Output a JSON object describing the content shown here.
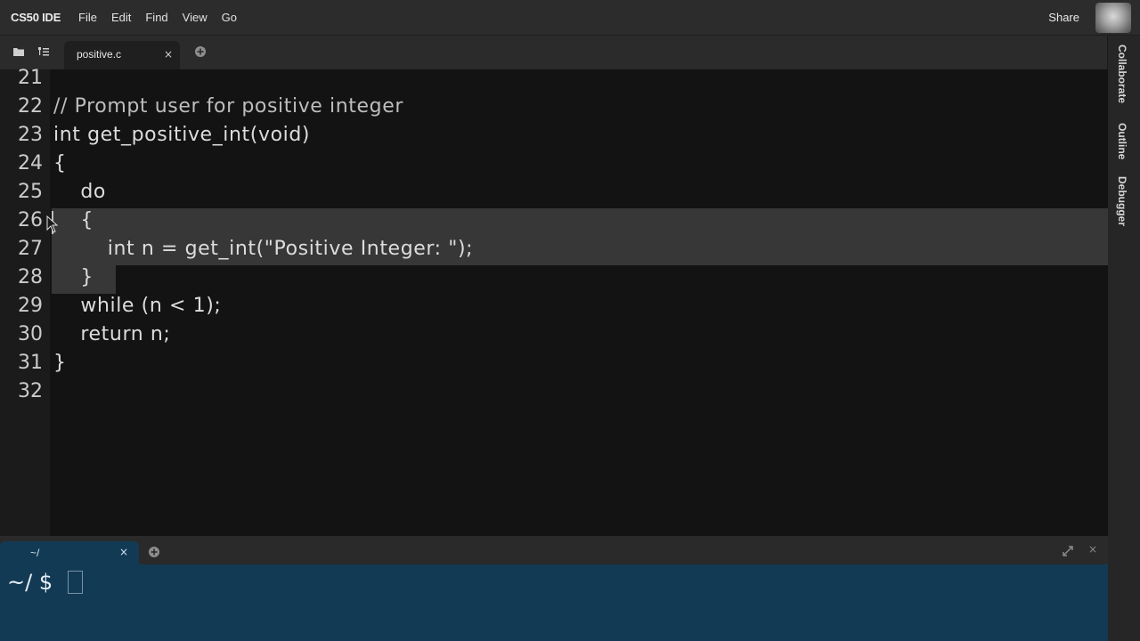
{
  "app": {
    "brand": "CS50 IDE",
    "menus": [
      "File",
      "Edit",
      "Find",
      "View",
      "Go"
    ],
    "share_label": "Share"
  },
  "tabs": {
    "active_tab": "positive.c",
    "close_glyph": "×"
  },
  "right_panel": {
    "labels": [
      "Collaborate",
      "Outline",
      "Debugger"
    ]
  },
  "editor": {
    "lines": [
      {
        "num": "21",
        "text": ""
      },
      {
        "num": "22",
        "text": "// Prompt user for positive integer"
      },
      {
        "num": "23",
        "text": "int get_positive_int(void)"
      },
      {
        "num": "24",
        "text": "{"
      },
      {
        "num": "25",
        "text": "    do"
      },
      {
        "num": "26",
        "text": "    {"
      },
      {
        "num": "27",
        "text": "        int n = get_int(\"Positive Integer: \");"
      },
      {
        "num": "28",
        "text": "    }"
      },
      {
        "num": "29",
        "text": "    while (n < 1);"
      },
      {
        "num": "30",
        "text": "    return n;"
      },
      {
        "num": "31",
        "text": "}"
      },
      {
        "num": "32",
        "text": ""
      }
    ],
    "selected_lines": [
      "26",
      "27",
      "28"
    ]
  },
  "terminal": {
    "tab_label": "~/",
    "close_glyph": "×",
    "prompt": "~/ $"
  },
  "colors": {
    "menubar": "#2c2c2c",
    "editor_bg": "#131313",
    "selection": "#373737",
    "terminal_bg": "#123a55"
  }
}
